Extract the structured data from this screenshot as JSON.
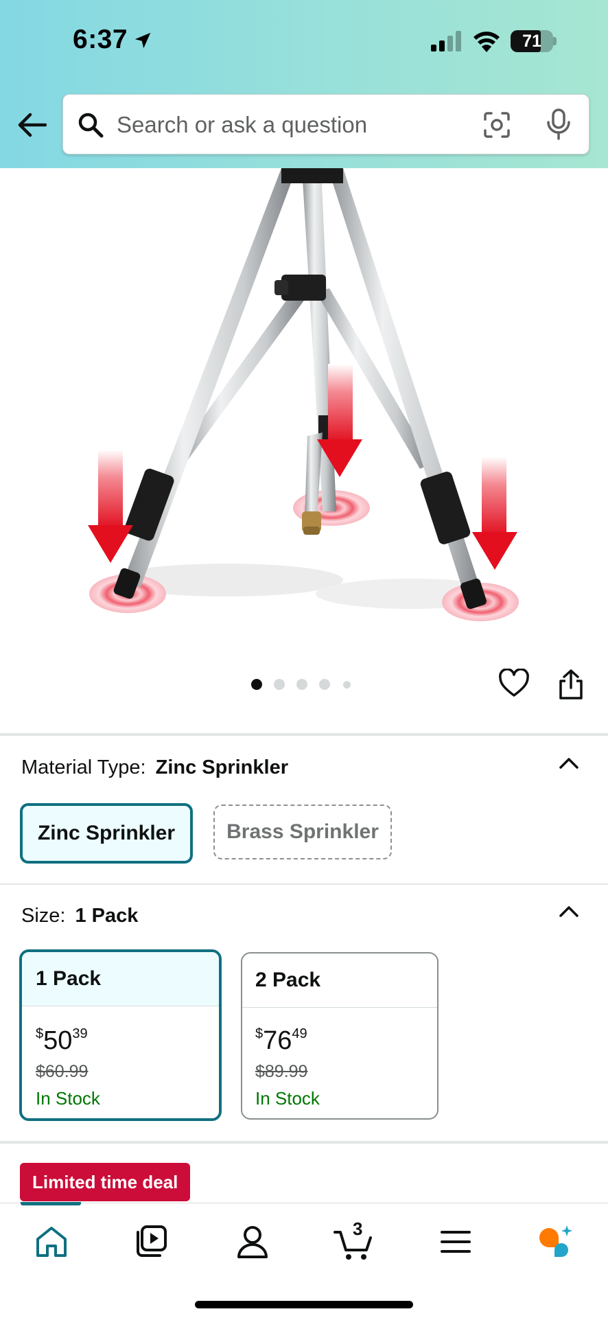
{
  "status_bar": {
    "time": "6:37",
    "battery": "71"
  },
  "search": {
    "placeholder": "Search or ask a question"
  },
  "gallery": {
    "image_count": 5,
    "active_index": 0
  },
  "material": {
    "label": "Material Type:",
    "selected_value": "Zinc Sprinkler",
    "options": [
      {
        "label": "Zinc Sprinkler",
        "state": "selected"
      },
      {
        "label": "Brass Sprinkler",
        "state": "unavailable"
      }
    ]
  },
  "size": {
    "label": "Size:",
    "selected_value": "1 Pack",
    "options": [
      {
        "label": "1 Pack",
        "currency": "$",
        "price_whole": "50",
        "price_cents": "39",
        "list_price": "$60.99",
        "availability": "In Stock",
        "state": "selected"
      },
      {
        "label": "2 Pack",
        "currency": "$",
        "price_whole": "76",
        "price_cents": "49",
        "list_price": "$89.99",
        "availability": "In Stock",
        "state": "normal"
      }
    ]
  },
  "deal": {
    "label": "Limited time deal"
  },
  "bottom_nav": {
    "items": [
      "home-icon",
      "video-icon",
      "account-icon",
      "cart-icon",
      "menu-icon",
      "rufus-icon"
    ],
    "cart_count": "3",
    "active_item": "home"
  },
  "colors": {
    "accent": "#0f7080",
    "deal": "#cc0c39",
    "in_stock": "#007600"
  }
}
